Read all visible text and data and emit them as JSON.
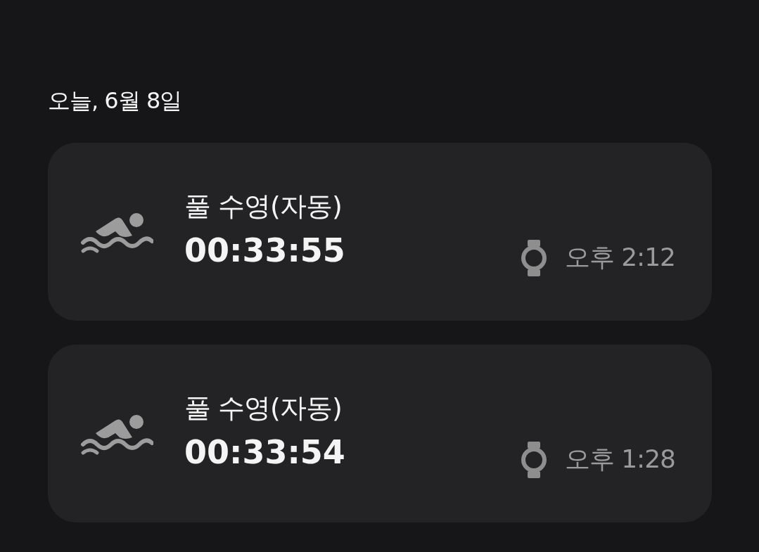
{
  "date_header": "오늘, 6월 8일",
  "workouts": [
    {
      "kind": "swim",
      "title": "풀 수영(자동)",
      "duration": "00:33:55",
      "time": "오후 2:12"
    },
    {
      "kind": "swim",
      "title": "풀 수영(자동)",
      "duration": "00:33:54",
      "time": "오후 1:28"
    }
  ]
}
